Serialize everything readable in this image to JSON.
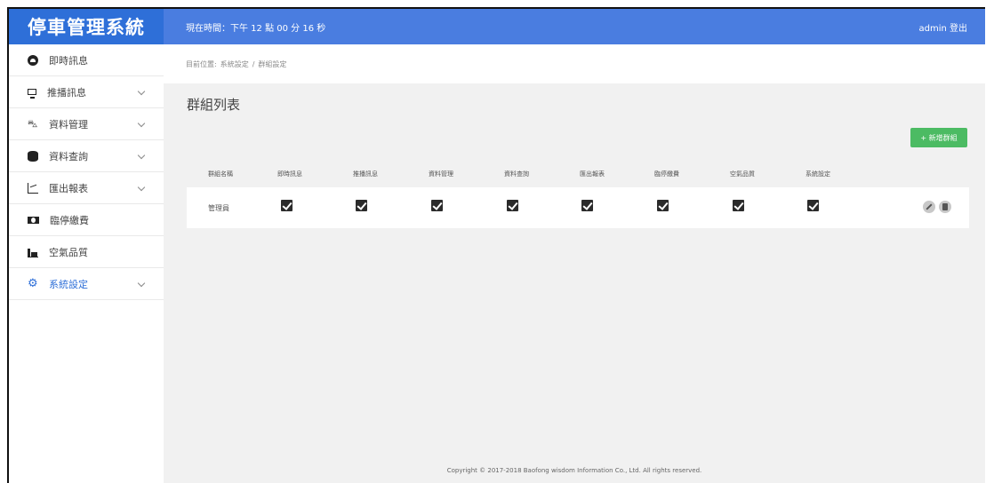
{
  "brand": "停車管理系統",
  "topbar": {
    "clock": "現在時間：下午 12 點 00 分 16 秒",
    "user": "admin 登出"
  },
  "breadcrumb": {
    "prefix": "目前位置:",
    "level1": "系統設定",
    "sep": "/",
    "level2": "群組設定"
  },
  "sidebar": {
    "items": [
      {
        "label": "即時訊息",
        "icon": "dashboard-icon"
      },
      {
        "label": "推播訊息",
        "icon": "monitor-icon"
      },
      {
        "label": "資料管理",
        "icon": "car-icon"
      },
      {
        "label": "資料查詢",
        "icon": "database-icon"
      },
      {
        "label": "匯出報表",
        "icon": "line-chart-icon"
      },
      {
        "label": "臨停繳費",
        "icon": "money-icon"
      },
      {
        "label": "空氣品質",
        "icon": "bar-chart-icon"
      },
      {
        "label": "系統設定",
        "icon": "gears-icon"
      }
    ]
  },
  "main": {
    "title": "群組列表",
    "add_button": "+ 新增群組",
    "columns": [
      "群組名稱",
      "即時訊息",
      "推播訊息",
      "資料管理",
      "資料查詢",
      "匯出報表",
      "臨停繳費",
      "空氣品質",
      "系統設定"
    ],
    "rows": [
      {
        "name": "管理員",
        "permissions": [
          true,
          true,
          true,
          true,
          true,
          true,
          true,
          true
        ]
      }
    ]
  },
  "footer": "Copyright © 2017-2018 Baofong wisdom Information Co., Ltd. All rights reserved.",
  "colors": {
    "brand": "#2e6fd8",
    "topbar": "#4a7de0",
    "add": "#4cbb63",
    "background": "#f1f1f1"
  }
}
